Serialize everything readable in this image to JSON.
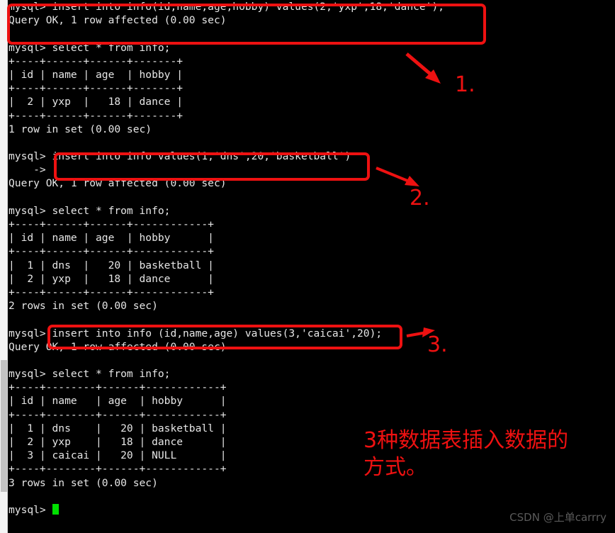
{
  "terminal": {
    "lines": [
      "mysql> insert into info(id,name,age,hobby) values(2,'yxp',18,'dance');",
      "Query OK, 1 row affected (0.00 sec)",
      "",
      "mysql> select * from info;",
      "+----+------+------+-------+",
      "| id | name | age  | hobby |",
      "+----+------+------+-------+",
      "|  2 | yxp  |   18 | dance |",
      "+----+------+------+-------+",
      "1 row in set (0.00 sec)",
      "",
      "mysql> insert into info values(1,'dns',20,'basketball')",
      "    -> ;",
      "Query OK, 1 row affected (0.00 sec)",
      "",
      "mysql> select * from info;",
      "+----+------+------+------------+",
      "| id | name | age  | hobby      |",
      "+----+------+------+------------+",
      "|  1 | dns  |   20 | basketball |",
      "|  2 | yxp  |   18 | dance      |",
      "+----+------+------+------------+",
      "2 rows in set (0.00 sec)",
      "",
      "mysql> insert into info (id,name,age) values(3,'caicai',20);",
      "Query OK, 1 row affected (0.00 sec)",
      "",
      "mysql> select * from info;",
      "+----+--------+------+------------+",
      "| id | name   | age  | hobby      |",
      "+----+--------+------+------------+",
      "|  1 | dns    |   20 | basketball |",
      "|  2 | yxp    |   18 | dance      |",
      "|  3 | caicai |   20 | NULL       |",
      "+----+--------+------+------------+",
      "3 rows in set (0.00 sec)",
      "",
      "mysql> "
    ],
    "prompt_final": "mysql> ",
    "cursor_color": "#00e000",
    "text_color": "#e6e6e6",
    "background_color": "#000000"
  },
  "annotations": {
    "box_color": "#ee1111",
    "numbers": [
      {
        "label": "1."
      },
      {
        "label": "2."
      },
      {
        "label": "3."
      }
    ],
    "caption_line_1": "3种数据表插入数据的",
    "caption_line_2": "方式。"
  },
  "watermark": {
    "text": "CSDN @上单carrry"
  }
}
